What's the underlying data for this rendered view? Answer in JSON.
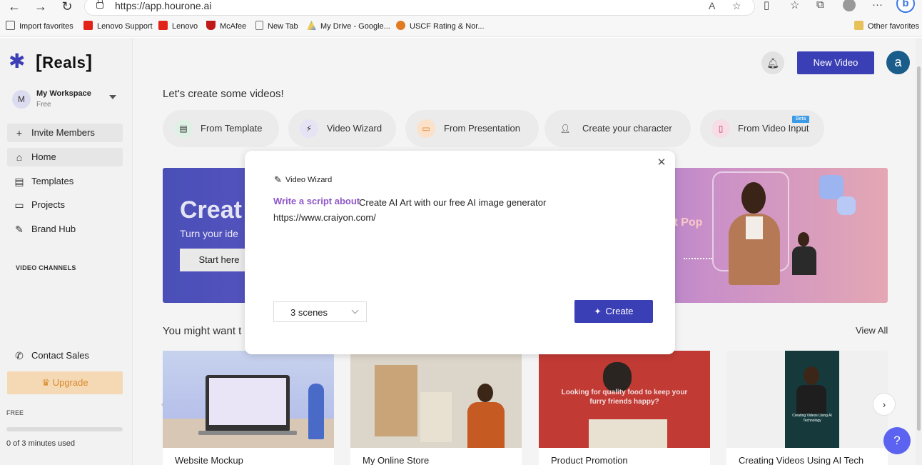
{
  "browser": {
    "url": "https://app.hourone.ai",
    "favorites": [
      {
        "label": "Import favorites",
        "color": "#555555"
      },
      {
        "label": "Lenovo Support",
        "color": "#e2231a"
      },
      {
        "label": "Lenovo",
        "color": "#e2231a"
      },
      {
        "label": "McAfee",
        "color": "#c01818"
      },
      {
        "label": "New Tab",
        "color": "#777777"
      },
      {
        "label": "My Drive - Google...",
        "color": "#1fa463"
      },
      {
        "label": "USCF Rating & Nor...",
        "color": "#e07b1f"
      }
    ],
    "other_favorites": "Other favorites"
  },
  "sidebar": {
    "logo": "Reals",
    "workspace": {
      "initial": "M",
      "name": "My Workspace",
      "plan": "Free"
    },
    "invite": "Invite Members",
    "items": [
      {
        "label": "Home",
        "icon": "home-icon"
      },
      {
        "label": "Templates",
        "icon": "templates-icon"
      },
      {
        "label": "Projects",
        "icon": "folder-icon"
      },
      {
        "label": "Brand Hub",
        "icon": "brand-hub-icon"
      }
    ],
    "channels_label": "VIDEO CHANNELS",
    "contact": "Contact Sales",
    "upgrade": "Upgrade",
    "free_label": "FREE",
    "usage": {
      "text": "0 of 3 minutes used",
      "fraction": 0
    }
  },
  "header": {
    "new_video": "New Video",
    "user_initial": "a"
  },
  "main": {
    "headline": "Let's create some videos!",
    "options": [
      {
        "label": "From Template",
        "icon": "template-icon",
        "color": "#dff0e4"
      },
      {
        "label": "Video Wizard",
        "icon": "wand-icon",
        "color": "#e6e3f5"
      },
      {
        "label": "From Presentation",
        "icon": "presentation-icon",
        "color": "#fbe1c9"
      },
      {
        "label": "Create your character",
        "icon": "add-person-icon",
        "color": "#ebebeb"
      },
      {
        "label": "From Video Input",
        "icon": "video-input-icon",
        "color": "#f6dde6"
      }
    ],
    "beta": "Beta",
    "banner": {
      "title": "Creat",
      "subtitle": "Turn your ide",
      "button": "Start here",
      "pop_text": "It Pop"
    },
    "might_want": "You might want t",
    "view_all": "View All",
    "cards": [
      {
        "title": "Website Mockup"
      },
      {
        "title": "My Online Store"
      },
      {
        "title": "Product Promotion",
        "overlay": "Looking for quality food to keep your furry friends happy?"
      },
      {
        "title": "Creating Videos Using AI Tech",
        "overlay": "Creating Videos Using AI Technology"
      }
    ]
  },
  "modal": {
    "title": "Video Wizard",
    "prompt_label": "Write a script about",
    "prompt_text": "Create AI Art with our free AI image generator",
    "prompt_url": "https://www.craiyon.com/",
    "scenes": "3 scenes",
    "create": "Create"
  }
}
